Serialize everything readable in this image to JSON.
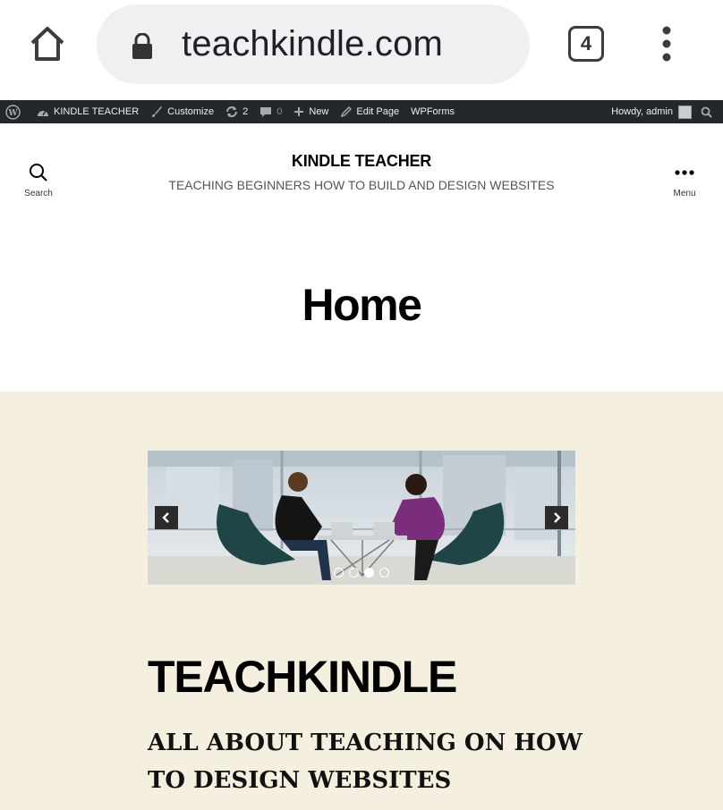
{
  "browser": {
    "url": "teachkindle.com",
    "tab_count": "4",
    "icons": {
      "home": "home-icon",
      "lock": "lock-icon",
      "more": "more-vert-icon"
    }
  },
  "adminbar": {
    "site_name": "KINDLE TEACHER",
    "customize": "Customize",
    "updates_count": "2",
    "comments_count": "0",
    "new": "New",
    "edit_page": "Edit Page",
    "wpforms": "WPForms",
    "howdy": "Howdy, admin"
  },
  "header": {
    "search_label": "Search",
    "menu_label": "Menu",
    "site_title": "KINDLE TEACHER",
    "site_description": "TEACHING BEGINNERS HOW TO BUILD AND DESIGN WEBSITES"
  },
  "page": {
    "title": "Home"
  },
  "slider": {
    "slide_count": 4,
    "active_index": 2
  },
  "content": {
    "heading": "TEACHKINDLE",
    "subheading_line1": "ALL ABOUT TEACHING ON HOW",
    "subheading_line2": "TO DESIGN WEBSITES"
  },
  "colors": {
    "adminbar_bg": "#23282d",
    "content_bg": "#f5efe0",
    "urlbar_bg": "#eef0f2"
  }
}
